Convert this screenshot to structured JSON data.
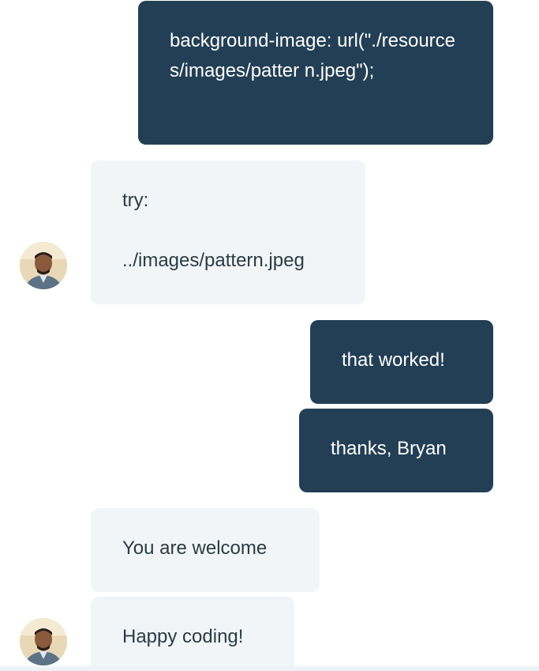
{
  "messages": [
    {
      "direction": "outgoing",
      "text": "background-image: url(\"./resources/images/patter n.jpeg\");"
    },
    {
      "direction": "incoming",
      "text": "try:\n\n../images/pattern.jpeg",
      "avatar": "user-avatar"
    },
    {
      "direction": "outgoing",
      "text": "that worked!"
    },
    {
      "direction": "outgoing",
      "text": "thanks, Bryan"
    },
    {
      "direction": "incoming",
      "text": "You are welcome"
    },
    {
      "direction": "incoming",
      "text": "Happy coding!",
      "avatar": "user-avatar"
    }
  ],
  "colors": {
    "outgoing_bubble": "#223f55",
    "incoming_bubble": "#f2f5f8",
    "outgoing_text": "#ffffff",
    "incoming_text": "#2a3b47"
  }
}
